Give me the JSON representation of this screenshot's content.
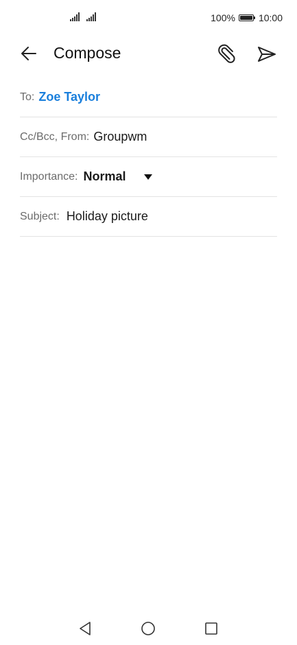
{
  "status_bar": {
    "signal_icons": [
      "signal-icon",
      "signal-icon"
    ],
    "battery_percent": "100%",
    "battery_level": 1.0,
    "time": "10:00"
  },
  "header": {
    "title": "Compose",
    "icons": {
      "back": "arrow-left-icon",
      "attach": "paperclip-icon",
      "send": "send-icon"
    }
  },
  "fields": {
    "to": {
      "label": "To:",
      "value": "Zoe Taylor"
    },
    "cc_from": {
      "label": "Cc/Bcc, From:",
      "value": "Groupwm"
    },
    "importance": {
      "label": "Importance:",
      "value": "Normal"
    },
    "subject": {
      "label": "Subject:",
      "value": "Holiday picture"
    }
  },
  "body": {
    "value": ""
  },
  "navbar": {
    "icons": [
      "triangle-back-icon",
      "circle-home-icon",
      "square-recents-icon"
    ]
  },
  "colors": {
    "accent": "#1a7fdc",
    "text": "#1a1a1a",
    "label": "#6b6b6b",
    "divider": "#e3e3e3"
  }
}
